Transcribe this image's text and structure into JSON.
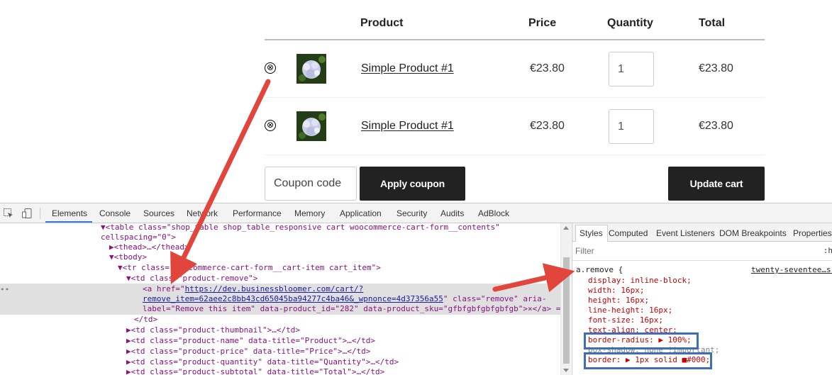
{
  "cart": {
    "headers": {
      "product": "Product",
      "price": "Price",
      "quantity": "Quantity",
      "total": "Total"
    },
    "items": [
      {
        "remove": "⊗",
        "name": "Simple Product #1",
        "price": "€23.80",
        "quantity": "1",
        "total": "€23.80"
      },
      {
        "remove": "⊗",
        "name": "Simple Product #1",
        "price": "€23.80",
        "quantity": "1",
        "total": "€23.80"
      }
    ],
    "coupon_placeholder": "Coupon code",
    "apply_coupon_label": "Apply coupon",
    "update_cart_label": "Update cart"
  },
  "devtools": {
    "tabs": [
      "Elements",
      "Console",
      "Sources",
      "Network",
      "Performance",
      "Memory",
      "Application",
      "Security",
      "Audits",
      "AdBlock"
    ],
    "active_tab": "Elements",
    "dom_lines": {
      "l1": "▼<table class=\"shop_table shop_table_responsive cart woocommerce-cart-form__contents\"",
      "l2": "cellspacing=\"0\">",
      "l3": "▶<thead>…</thead>",
      "l4": "▼<tbody>",
      "l5": "▼<tr class=\"woocommerce-cart-form__cart-item cart_item\">",
      "l6": "▼<td class=\"product-remove\">",
      "l7a": "<a href=\"",
      "l7b": "https://dev.businessbloomer.com/cart/?",
      "l8a": "remove_item=62aee2c8bb43cd65045ba94277c4ba46&_wpnonce=4d37356a55",
      "l8b": "\" class=\"remove\" aria-",
      "l9": "label=\"Remove this item\" data-product_id=\"282\" data-product_sku=\"gfbfgbfgbfgbfgb\">×</a> ==",
      "l10": "</td>",
      "l11": "▶<td class=\"product-thumbnail\">…</td>",
      "l12": "▶<td class=\"product-name\" data-title=\"Product\">…</td>",
      "l13": "▶<td class=\"product-price\" data-title=\"Price\">…</td>",
      "l14": "▶<td class=\"product-quantity\" data-title=\"Quantity\">…</td>",
      "l15": "▶<td class=\"product-subtotal\" data-title=\"Total\">…</td>"
    },
    "styles_tabs": [
      "Styles",
      "Computed",
      "Event Listeners",
      "DOM Breakpoints",
      "Properties"
    ],
    "filter_placeholder": "Filter",
    "filter_hov": ":h",
    "rule": {
      "selector": "a.remove {",
      "source": "twenty-seventee…s:",
      "declarations": [
        "display: inline-block;",
        "width: 16px;",
        "height: 16px;",
        "line-height: 16px;",
        "font-size: 16px;",
        "text-align: center;",
        "border-radius: ▶ 100%;",
        "box-shadow: none !important;",
        "border: ▶ 1px solid ■#000;"
      ]
    }
  },
  "colors": {
    "highlight_box": "#3e6fb6",
    "arrow": "#e2453c",
    "button_dark": "#222222"
  }
}
